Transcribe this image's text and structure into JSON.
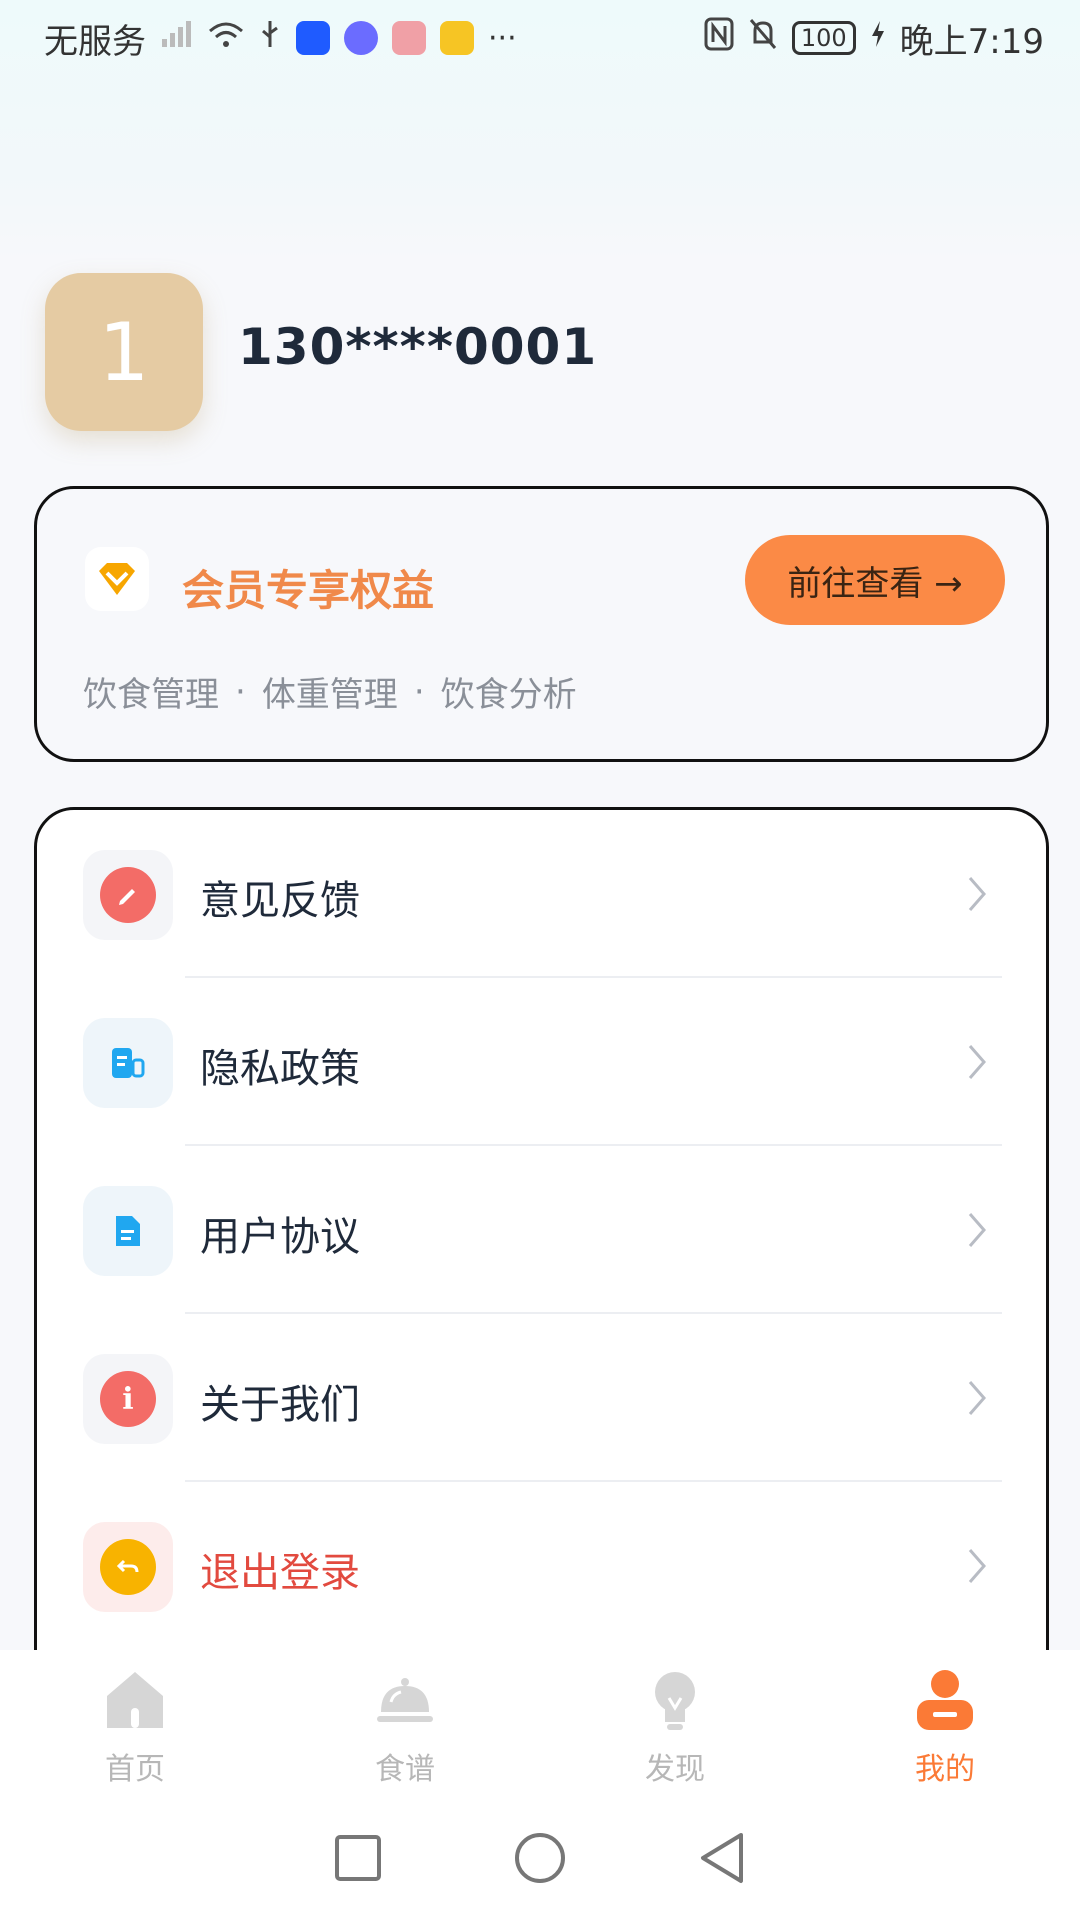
{
  "status_bar": {
    "left_text": "无服务",
    "right_time": "晚上7:19",
    "battery": "100"
  },
  "profile": {
    "avatar_char": "1",
    "phone": "130****0001"
  },
  "vip": {
    "title": "会员专享权益",
    "button": "前往查看 →",
    "features": [
      "饮食管理",
      "体重管理",
      "饮食分析"
    ],
    "accent": "#fb8a46"
  },
  "menu": [
    {
      "label": "意见反馈",
      "icon": "edit-icon",
      "color": "#f36c67"
    },
    {
      "label": "隐私政策",
      "icon": "document-icon",
      "color": "#20a7f0"
    },
    {
      "label": "用户协议",
      "icon": "file-icon",
      "color": "#20a7f0"
    },
    {
      "label": "关于我们",
      "icon": "info-icon",
      "color": "#f36c67"
    },
    {
      "label": "退出登录",
      "icon": "logout-icon",
      "color": "#f8b300",
      "danger_color": "#e24a3f"
    }
  ],
  "tabs": [
    {
      "label": "首页"
    },
    {
      "label": "食谱"
    },
    {
      "label": "发现"
    },
    {
      "label": "我的"
    }
  ]
}
